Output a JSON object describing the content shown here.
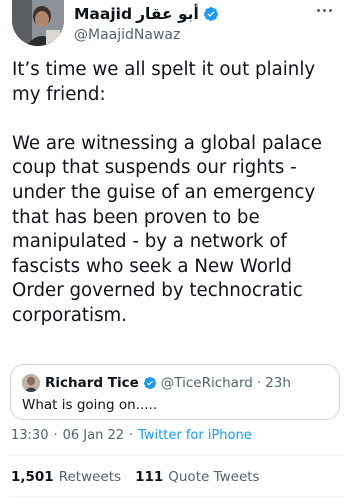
{
  "author": {
    "name": "Maajid",
    "name_arabic": "أبو عقار",
    "handle": "@MaajidNawaz"
  },
  "tweet": {
    "text": "It’s time we all spelt it out plainly\nmy friend:\n\nWe are witnessing a global palace\ncoup that suspends our rights -\nunder the guise of an emergency\nthat has been proven to be\nmanipulated - by a network of\nfascists who seek a New World\nOrder governed by technocratic\ncorporatism."
  },
  "quote": {
    "name": "Richard Tice",
    "handle": "@TiceRichard",
    "dot": "·",
    "time": "23h",
    "text": "What is going on....."
  },
  "meta": {
    "time": "13:30",
    "sep1": "·",
    "date": "06 Jan 22",
    "sep2": "·",
    "source": "Twitter for iPhone"
  },
  "stats": {
    "retweets_count": "1,501",
    "retweets_label": "Retweets",
    "quotes_count": "111",
    "quotes_label": "Quote Tweets"
  },
  "colors": {
    "verified": "#1d9bf0",
    "link": "#1d9bf0",
    "secondary_text": "#536471",
    "border": "#cfd9de"
  },
  "icons": [
    "verified-badge-icon",
    "more-options-icon"
  ]
}
